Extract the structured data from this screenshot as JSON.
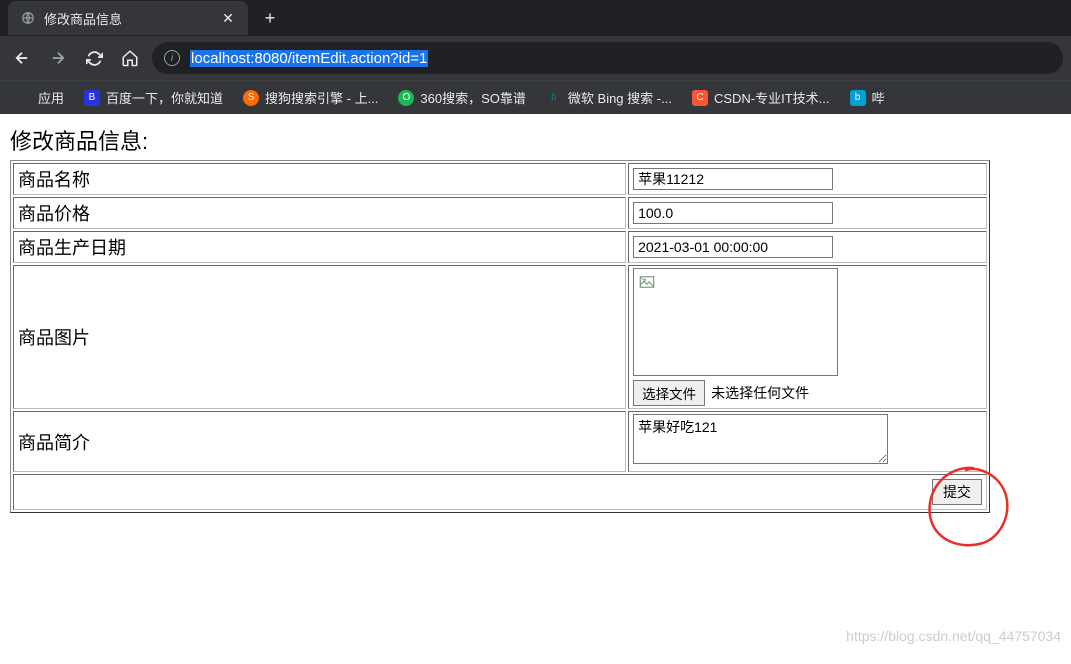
{
  "browser": {
    "tab_title": "修改商品信息",
    "url_display": "localhost:8080/itemEdit.action?id=1",
    "bookmarks": {
      "apps": "应用",
      "baidu": "百度一下，你就知道",
      "sogou": "搜狗搜索引擎 - 上...",
      "so360": "360搜索，SO靠谱",
      "bing": "微软 Bing 搜索 -...",
      "csdn": "CSDN-专业IT技术...",
      "bilibili": "哔"
    }
  },
  "form": {
    "title": "修改商品信息:",
    "labels": {
      "name": "商品名称",
      "price": "商品价格",
      "date": "商品生产日期",
      "image": "商品图片",
      "desc": "商品简介"
    },
    "values": {
      "name": "苹果11212",
      "price": "100.0",
      "date": "2021-03-01 00:00:00",
      "desc": "苹果好吃121"
    },
    "file_button": "选择文件",
    "file_status": "未选择任何文件",
    "submit": "提交"
  },
  "watermark": "https://blog.csdn.net/qq_44757034"
}
